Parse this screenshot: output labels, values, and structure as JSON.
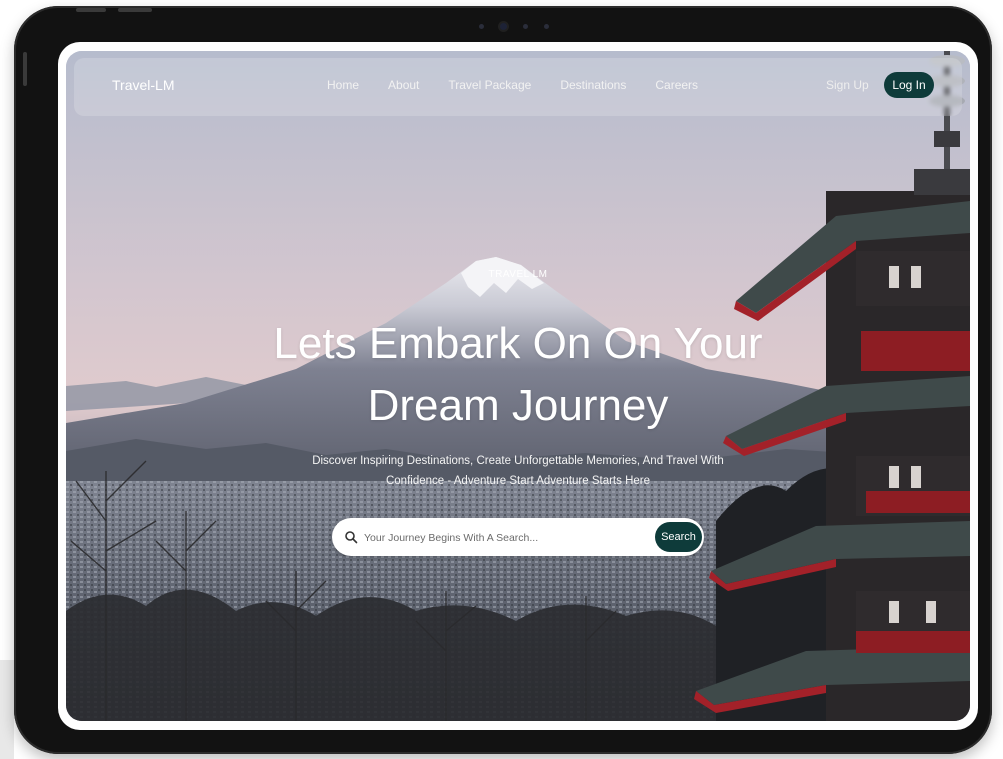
{
  "nav": {
    "logo": "Travel-LM",
    "links": [
      "Home",
      "About",
      "Travel Package",
      "Destinations",
      "Careers"
    ],
    "signup": "Sign Up",
    "login": "Log In"
  },
  "hero": {
    "eyebrow": "TRAVEL LM",
    "headline_line1": "Lets Embark On On Your",
    "headline_line2": "Dream Journey",
    "subtext_line1": "Discover Inspiring Destinations, Create Unforgettable Memories, And Travel With",
    "subtext_line2": "Confidence - Adventure Start Adventure Starts Here"
  },
  "search": {
    "placeholder": "Your Journey Begins With A Search...",
    "button_label": "Search"
  },
  "colors": {
    "accent": "#0e3b3a",
    "device_frame": "#121212"
  }
}
